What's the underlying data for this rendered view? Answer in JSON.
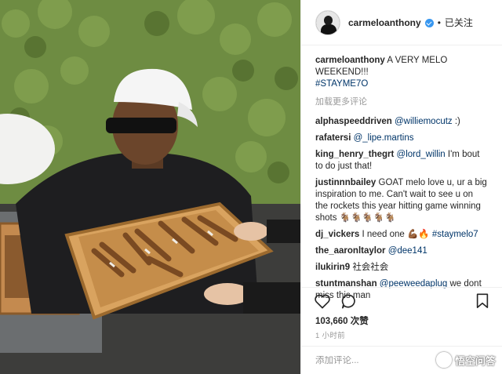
{
  "header": {
    "username": "carmeloanthony",
    "separator": "•",
    "follow_status": "已关注"
  },
  "caption": {
    "username": "carmeloanthony",
    "text": "A VERY MELO WEEKEND!!!",
    "hashtag": "#STAYME7O"
  },
  "load_more": "加载更多评论",
  "comments": [
    {
      "user": "alphaspeeddriven",
      "mention": "@williemocutz",
      "text": " :)"
    },
    {
      "user": "rafatersi",
      "mention": "@_lipe.martins",
      "text": ""
    },
    {
      "user": "king_henry_thegrt",
      "mention": "@lord_willin",
      "text": " I'm bout to do just that!"
    },
    {
      "user": "justinnnbailey",
      "text": "GOAT melo love u, ur a big inspiration to me. Can't wait to see u on the rockets this year hitting game winning shots 🐐🐐🐐🐐🐐"
    },
    {
      "user": "dj_vickers",
      "text": "I need one 💪🏾🔥 ",
      "hashtag": "#staymelo7"
    },
    {
      "user": "the_aaronltaylor",
      "mention": "@dee141",
      "text": ""
    },
    {
      "user": "ilukirin9",
      "text": "社会社会"
    },
    {
      "user": "stuntmanshan",
      "mention": "@peeweedaplug",
      "text": " we dont miss this man"
    }
  ],
  "actions": {
    "like_icon": "heart-icon",
    "comment_icon": "comment-icon",
    "save_icon": "bookmark-icon"
  },
  "likes": "103,660 次赞",
  "time": "1 小时前",
  "add_comment_placeholder": "添加评论...",
  "watermark": "悟空问答",
  "colors": {
    "link": "#003569",
    "verified": "#3897f0",
    "muted": "#999999"
  }
}
